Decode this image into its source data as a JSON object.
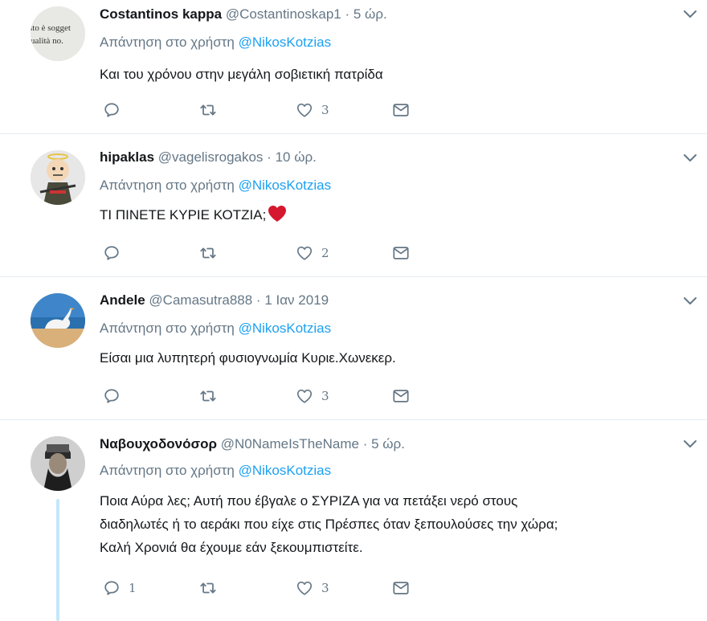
{
  "reply_prefix": "Απάντηση στο χρήστη",
  "tweets": [
    {
      "name": "Costantinos kappa",
      "handle": "@Costantinoskap1",
      "separator": "·",
      "time": "5 ώρ.",
      "mention": "@NikosKotzias",
      "text": "Και του χρόνου στην μεγάλη σοβιετική πατρίδα",
      "avatar_text_1": "sto è sogget",
      "avatar_text_2": "ualità no.",
      "replies": "",
      "likes": "3"
    },
    {
      "name": "hipaklas",
      "handle": "@vagelisrogakos",
      "separator": "·",
      "time": "10 ώρ.",
      "mention": "@NikosKotzias",
      "text": "ΤΙ ΠΙΝΕΤΕ ΚΥΡΙΕ ΚΟΤΖΙΑ;",
      "replies": "",
      "likes": "2"
    },
    {
      "name": "Andele",
      "handle": "@Camasutra888",
      "separator": "·",
      "time": "1 Ιαν 2019",
      "mention": "@NikosKotzias",
      "text": "Είσαι μια λυπητερή φυσιογνωμία Κυριε.Χωνεκερ.",
      "replies": "",
      "likes": "3"
    },
    {
      "name": "Ναβουχοδονόσορ",
      "handle": "@N0NameIsTheName",
      "separator": "·",
      "time": "5 ώρ.",
      "mention": "@NikosKotzias",
      "text_lines": [
        "Ποια Αύρα λες; Αυτή που έβγαλε ο ΣΥΡΙΖΑ για να πετάξει νερό στους",
        "διαδηλωτές ή το αεράκι που είχε στις Πρέσπες όταν ξεπουλούσες την χώρα;",
        "Καλή Χρονιά θα έχουμε εάν ξεκουμπιστείτε."
      ],
      "replies": "1",
      "likes": "3"
    }
  ]
}
